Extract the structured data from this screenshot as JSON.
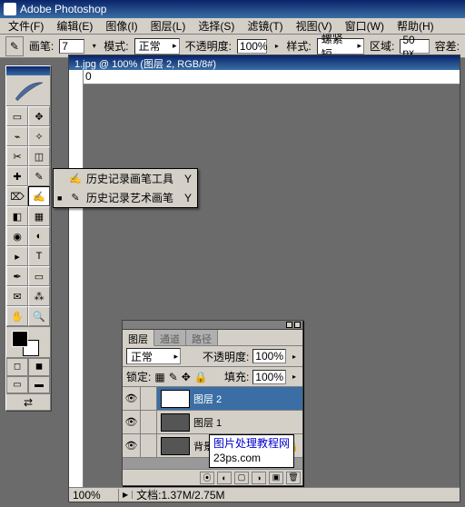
{
  "app": {
    "title": "Adobe Photoshop"
  },
  "menu": [
    "文件(F)",
    "编辑(E)",
    "图像(I)",
    "图层(L)",
    "选择(S)",
    "滤镜(T)",
    "视图(V)",
    "窗口(W)",
    "帮助(H)"
  ],
  "opt": {
    "brush_label": "画笔:",
    "brush_size": "7",
    "mode_label": "模式:",
    "mode_value": "正常",
    "opacity_label": "不透明度:",
    "opacity_value": "100%",
    "style_label": "样式:",
    "style_value": "螺紧短",
    "area_label": "区域:",
    "area_value": "50 px",
    "tol_label": "容差:"
  },
  "flyout": {
    "items": [
      {
        "mark": "",
        "name": "历史记录画笔工具",
        "key": "Y"
      },
      {
        "mark": "■",
        "name": "历史记录艺术画笔",
        "key": "Y"
      }
    ]
  },
  "doc": {
    "title": "1.jpg @ 100% (图层 2, RGB/8#)",
    "ruler_h": "0",
    "zoom": "100%",
    "status": "文档:1.37M/2.75M"
  },
  "panel": {
    "tabs": [
      "图层",
      "通道",
      "路径"
    ],
    "mode": "正常",
    "opacity_label": "不透明度:",
    "opacity_value": "100%",
    "lock_label": "锁定:",
    "fill_label": "填充:",
    "fill_value": "100%",
    "layers": [
      {
        "name": "图层 2",
        "sel": true,
        "blank": true
      },
      {
        "name": "图层 1",
        "sel": false,
        "blank": false
      },
      {
        "name": "背景",
        "sel": false,
        "blank": false
      }
    ]
  },
  "watermark": {
    "l1": "图片处理教程网",
    "l2": "23ps.com"
  }
}
